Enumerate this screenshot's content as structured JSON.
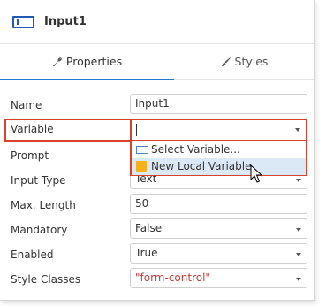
{
  "header": {
    "title": "Input1",
    "icon": "input-field-icon"
  },
  "tabs": [
    {
      "label": "Properties",
      "icon": "wrench-icon",
      "active": true
    },
    {
      "label": "Styles",
      "icon": "brush-icon",
      "active": false
    }
  ],
  "properties": {
    "name": {
      "label": "Name",
      "value": "Input1"
    },
    "variable": {
      "label": "Variable",
      "value": ""
    },
    "prompt": {
      "label": "Prompt"
    },
    "input_type": {
      "label": "Input Type",
      "value": "Text"
    },
    "max_length": {
      "label": "Max. Length",
      "value": "50"
    },
    "mandatory": {
      "label": "Mandatory",
      "value": "False"
    },
    "enabled": {
      "label": "Enabled",
      "value": "True"
    },
    "style_classes": {
      "label": "Style Classes",
      "value": "\"form-control\""
    }
  },
  "variable_dropdown": {
    "items": [
      {
        "label": "Select Variable...",
        "icon": "variable-icon"
      },
      {
        "label": "New Local Variable",
        "icon": "local-variable-icon",
        "hovered": true
      }
    ]
  },
  "colors": {
    "accent": "#1f78d1",
    "highlight": "#d9412b",
    "hover": "#dbe8f6",
    "local_variable": "#f5b21b",
    "style_class_text": "#c53a3a"
  }
}
